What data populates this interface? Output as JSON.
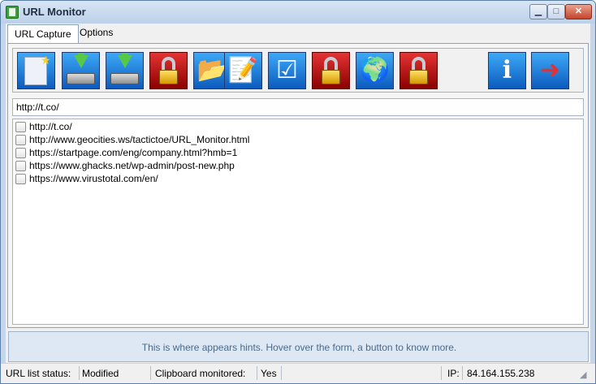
{
  "window": {
    "title": "URL Monitor"
  },
  "tabs": [
    "URL Capture",
    "Options"
  ],
  "toolbar": {
    "buttons": [
      {
        "name": "new-list",
        "icon": "new-document-icon",
        "color": "#1d7fe0"
      },
      {
        "name": "import",
        "icon": "download-drive-icon",
        "color": "#1d7fe0"
      },
      {
        "name": "export",
        "icon": "export-drive-icon",
        "color": "#1d7fe0"
      },
      {
        "name": "locked-1",
        "icon": "lock-icon",
        "color": "#c00000"
      },
      {
        "name": "open-folder",
        "icon": "folder-document-icon",
        "color": "#1d7fe0"
      },
      {
        "name": "edit",
        "icon": "notepad-pen-icon",
        "color": "#1d7fe0"
      },
      {
        "name": "checklist",
        "icon": "checklist-icon",
        "color": "#1d7fe0"
      },
      {
        "name": "locked-2",
        "icon": "lock-icon",
        "color": "#c00000"
      },
      {
        "name": "browse",
        "icon": "globe-icon",
        "color": "#1d7fe0"
      },
      {
        "name": "locked-3",
        "icon": "lock-icon",
        "color": "#c00000"
      },
      {
        "name": "about",
        "icon": "info-icon",
        "color": "#1d7fe0"
      },
      {
        "name": "exit",
        "icon": "exit-door-icon",
        "color": "#1d7fe0"
      }
    ]
  },
  "url_input": {
    "value": "http://t.co/"
  },
  "url_list": [
    "http://t.co/",
    "http://www.geocities.ws/tactictoe/URL_Monitor.html",
    "https://startpage.com/eng/company.html?hmb=1",
    "https://www.ghacks.net/wp-admin/post-new.php",
    "https://www.virustotal.com/en/"
  ],
  "hint": "This is where appears hints. Hover over the form, a button to know more.",
  "status": {
    "url_list_label": "URL list status:",
    "url_list_value": "Modified",
    "clipboard_label": "Clipboard monitored:",
    "clipboard_value": "Yes",
    "ip_label": "IP:",
    "ip_value": "84.164.155.238"
  }
}
